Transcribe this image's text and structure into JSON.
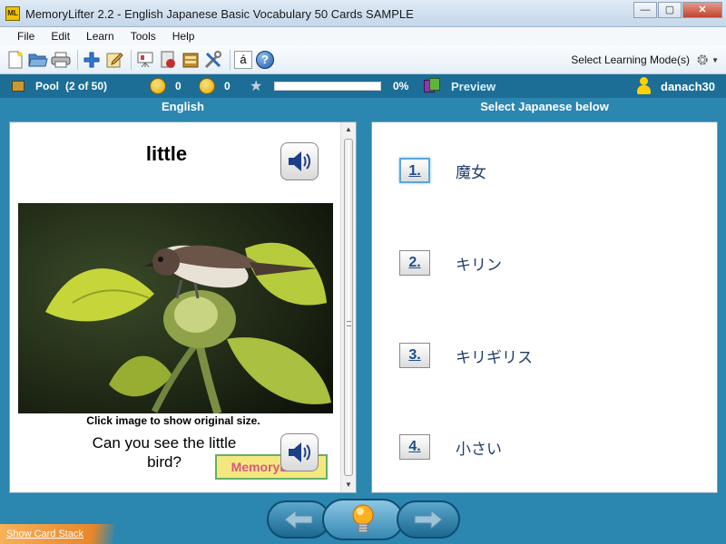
{
  "window": {
    "app_icon_label": "ML",
    "title": "MemoryLifter 2.2 - English Japanese Basic Vocabulary 50 Cards SAMPLE",
    "minimize_glyph": "—",
    "maximize_glyph": "▢",
    "close_glyph": "✕"
  },
  "menu": [
    "File",
    "Edit",
    "Learn",
    "Tools",
    "Help"
  ],
  "toolbar": {
    "icons": [
      "new-file-icon",
      "open-folder-icon",
      "print-icon",
      "add-card-icon",
      "edit-icon",
      "presentation-icon",
      "statistics-icon",
      "card-box-icon",
      "settings-tools-icon",
      "special-character-icon",
      "help-icon"
    ],
    "special_char_glyph": "á",
    "help_glyph": "?",
    "learning_mode_label": "Select Learning Mode(s)"
  },
  "status": {
    "pool_label": "Pool",
    "pool_count": "(2 of 50)",
    "correct_count": "0",
    "wrong_count": "0",
    "progress_fraction": 0.0,
    "progress_text": "0%",
    "preview_label": "Preview",
    "user_name": "danach30"
  },
  "columns": {
    "left_header": "English",
    "right_header": "Select Japanese below"
  },
  "question": {
    "word": "little",
    "image_caption": "Click image to show original size.",
    "example_sentence": "Can you see the little bird?",
    "watermark": "MemoryLifter"
  },
  "answers": [
    {
      "number": "1.",
      "text": "魔女"
    },
    {
      "number": "2.",
      "text": "キリン"
    },
    {
      "number": "3.",
      "text": "キリギリス"
    },
    {
      "number": "4.",
      "text": "小さい"
    }
  ],
  "footer": {
    "show_card_stack": "Show Card Stack"
  }
}
